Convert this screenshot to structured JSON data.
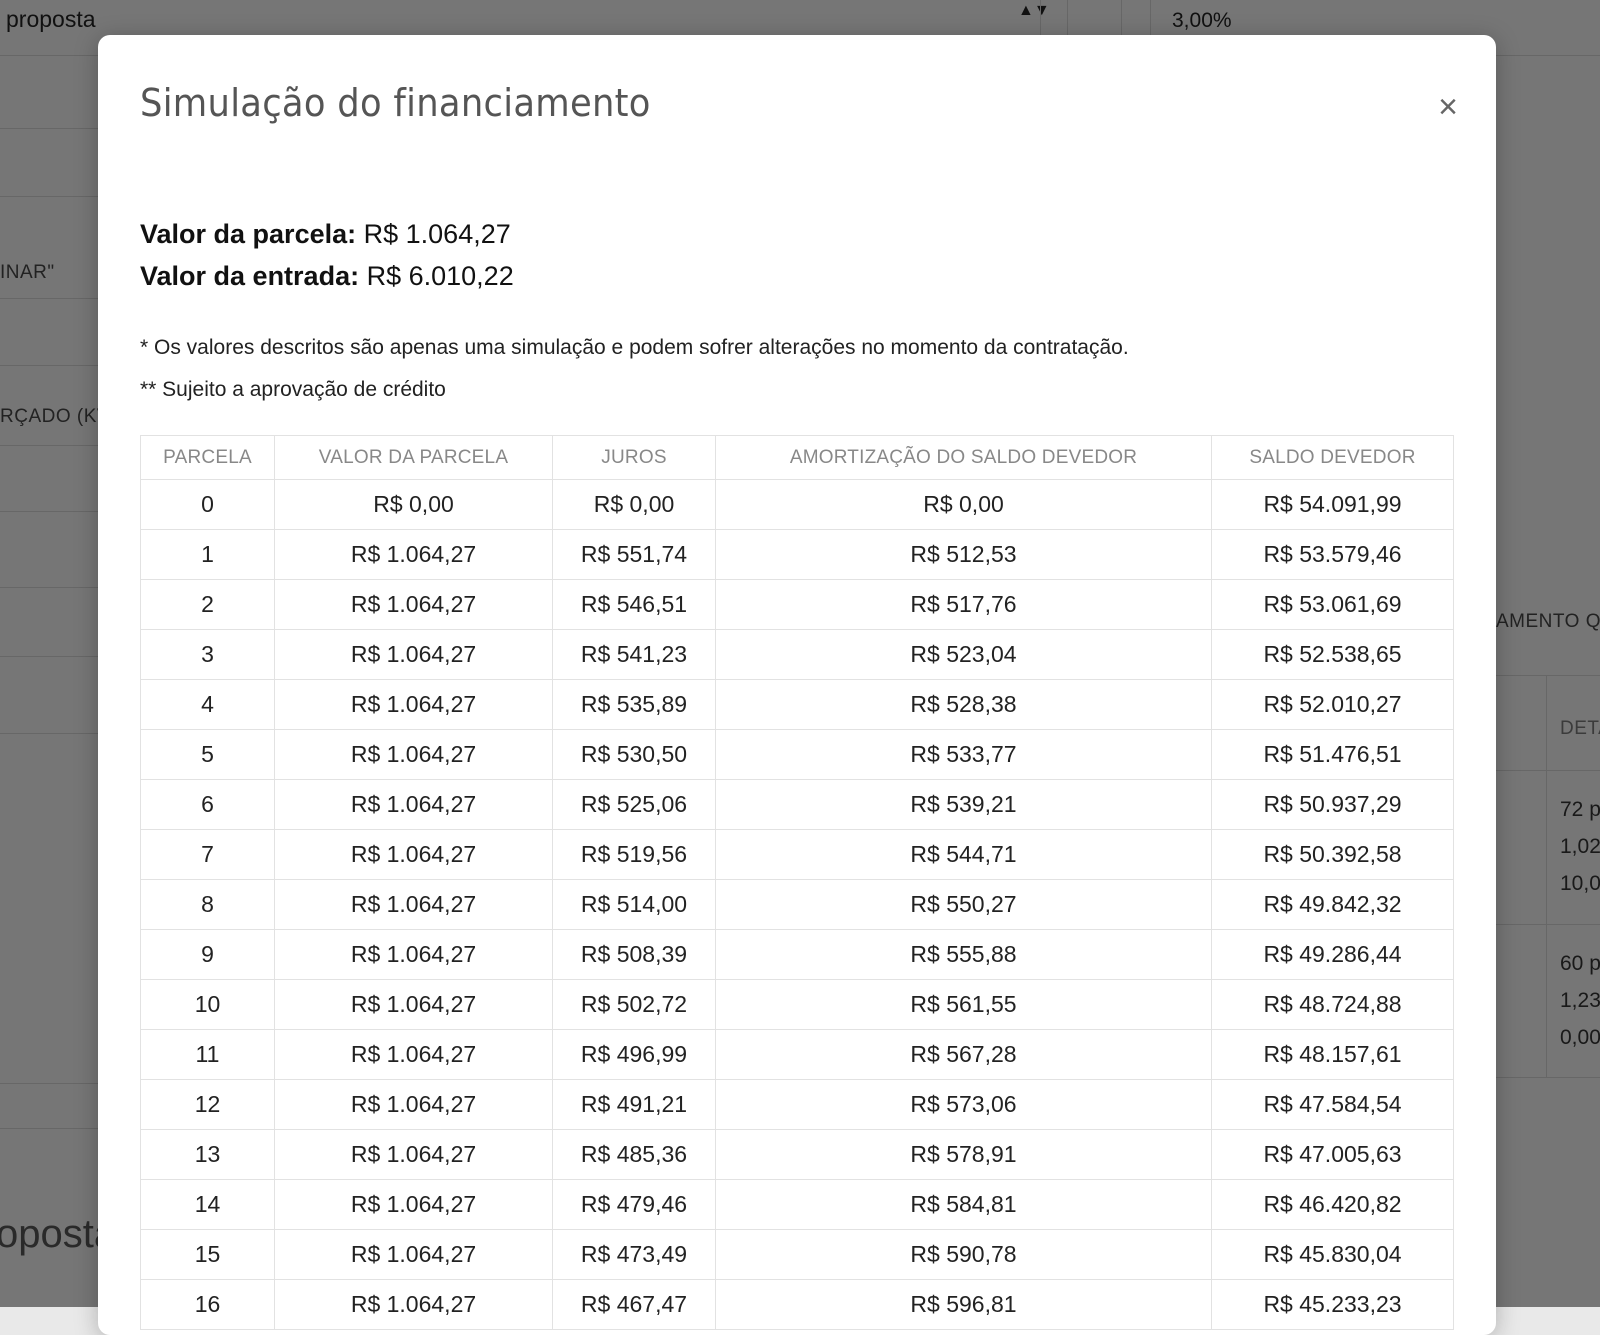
{
  "background": {
    "select_value": "proposta",
    "select_arrow": "▲▼",
    "percent_value": "3,00%",
    "label_inar": "INAR\"",
    "label_rcado": "RÇADO (KV",
    "label_amento": "AMENTO QU",
    "label_deta": "DETA",
    "cell_lines_1": [
      "72 p",
      "1,02",
      "10,0"
    ],
    "cell_lines_2": [
      "60 p",
      "1,23",
      "0,00"
    ],
    "big_text": "oposta"
  },
  "modal": {
    "title": "Simulação do financiamento",
    "close_label": "×",
    "parcela_label": "Valor da parcela:",
    "parcela_value": "R$ 1.064,27",
    "entrada_label": "Valor da entrada:",
    "entrada_value": "R$ 6.010,22",
    "note_1": "* Os valores descritos são apenas uma simulação e podem sofrer alterações no momento da contratação.",
    "note_2": "** Sujeito a aprovação de crédito"
  },
  "table": {
    "headers": [
      "PARCELA",
      "VALOR DA PARCELA",
      "JUROS",
      "AMORTIZAÇÃO DO SALDO DEVEDOR",
      "SALDO DEVEDOR"
    ],
    "rows": [
      [
        "0",
        "R$ 0,00",
        "R$ 0,00",
        "R$ 0,00",
        "R$ 54.091,99"
      ],
      [
        "1",
        "R$ 1.064,27",
        "R$ 551,74",
        "R$ 512,53",
        "R$ 53.579,46"
      ],
      [
        "2",
        "R$ 1.064,27",
        "R$ 546,51",
        "R$ 517,76",
        "R$ 53.061,69"
      ],
      [
        "3",
        "R$ 1.064,27",
        "R$ 541,23",
        "R$ 523,04",
        "R$ 52.538,65"
      ],
      [
        "4",
        "R$ 1.064,27",
        "R$ 535,89",
        "R$ 528,38",
        "R$ 52.010,27"
      ],
      [
        "5",
        "R$ 1.064,27",
        "R$ 530,50",
        "R$ 533,77",
        "R$ 51.476,51"
      ],
      [
        "6",
        "R$ 1.064,27",
        "R$ 525,06",
        "R$ 539,21",
        "R$ 50.937,29"
      ],
      [
        "7",
        "R$ 1.064,27",
        "R$ 519,56",
        "R$ 544,71",
        "R$ 50.392,58"
      ],
      [
        "8",
        "R$ 1.064,27",
        "R$ 514,00",
        "R$ 550,27",
        "R$ 49.842,32"
      ],
      [
        "9",
        "R$ 1.064,27",
        "R$ 508,39",
        "R$ 555,88",
        "R$ 49.286,44"
      ],
      [
        "10",
        "R$ 1.064,27",
        "R$ 502,72",
        "R$ 561,55",
        "R$ 48.724,88"
      ],
      [
        "11",
        "R$ 1.064,27",
        "R$ 496,99",
        "R$ 567,28",
        "R$ 48.157,61"
      ],
      [
        "12",
        "R$ 1.064,27",
        "R$ 491,21",
        "R$ 573,06",
        "R$ 47.584,54"
      ],
      [
        "13",
        "R$ 1.064,27",
        "R$ 485,36",
        "R$ 578,91",
        "R$ 47.005,63"
      ],
      [
        "14",
        "R$ 1.064,27",
        "R$ 479,46",
        "R$ 584,81",
        "R$ 46.420,82"
      ],
      [
        "15",
        "R$ 1.064,27",
        "R$ 473,49",
        "R$ 590,78",
        "R$ 45.830,04"
      ],
      [
        "16",
        "R$ 1.064,27",
        "R$ 467,47",
        "R$ 596,81",
        "R$ 45.233,23"
      ]
    ]
  }
}
